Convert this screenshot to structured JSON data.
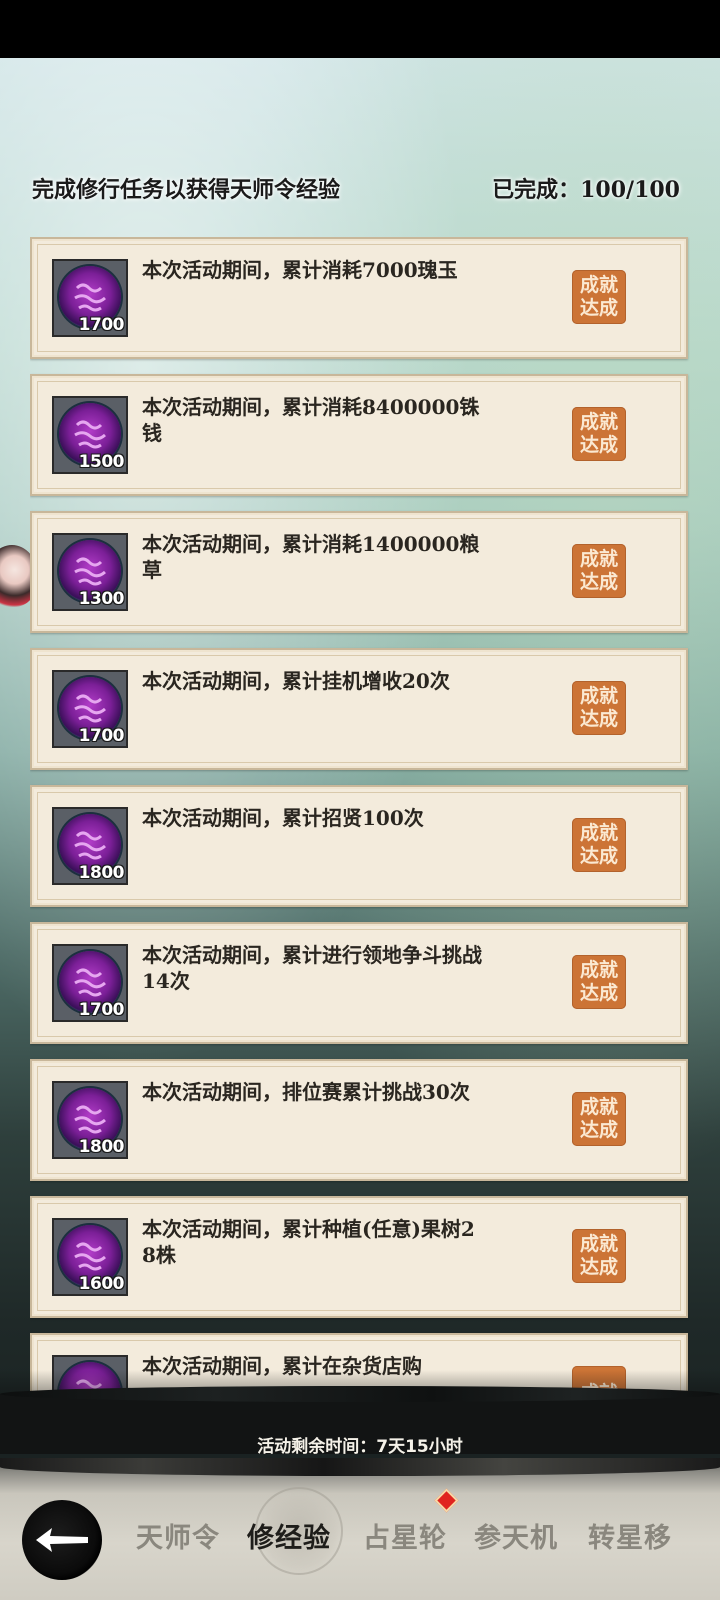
{
  "header": {
    "title": "完成修行任务以获得天师令经验",
    "progress": "已完成：100/100"
  },
  "tasks": [
    {
      "desc": "本次活动期间，累计消耗7000瑰玉",
      "reward": "1700",
      "status": "成就\n达成"
    },
    {
      "desc": "本次活动期间，累计消耗8400000铢钱",
      "reward": "1500",
      "status": "成就\n达成"
    },
    {
      "desc": "本次活动期间，累计消耗1400000粮草",
      "reward": "1300",
      "status": "成就\n达成"
    },
    {
      "desc": "本次活动期间，累计挂机增收20次",
      "reward": "1700",
      "status": "成就\n达成"
    },
    {
      "desc": "本次活动期间，累计招贤100次",
      "reward": "1800",
      "status": "成就\n达成"
    },
    {
      "desc": "本次活动期间，累计进行领地争斗挑战14次",
      "reward": "1700",
      "status": "成就\n达成"
    },
    {
      "desc": "本次活动期间，排位赛累计挑战30次",
      "reward": "1800",
      "status": "成就\n达成"
    },
    {
      "desc": "本次活动期间，累计种植(任意)果树28株",
      "reward": "1600",
      "status": "成就\n达成"
    },
    {
      "desc": "本次活动期间，累计在杂货店购",
      "reward": "",
      "status": "成就"
    }
  ],
  "footer": {
    "timer": "活动剩余时间：7天15小时"
  },
  "tabs": [
    {
      "label": "天师令"
    },
    {
      "label": "修经验"
    },
    {
      "label": "占星轮"
    },
    {
      "label": "参天机"
    },
    {
      "label": "转星移"
    }
  ],
  "icons": {
    "back": "back-arrow-icon",
    "reward": "emblem-icon"
  },
  "colors": {
    "stamp": "#cc7436",
    "card": "#f3ebdc",
    "active_tab": "#1e1d1a",
    "inactive_tab": "#8a877e",
    "badge_dot": "#e0241f"
  }
}
